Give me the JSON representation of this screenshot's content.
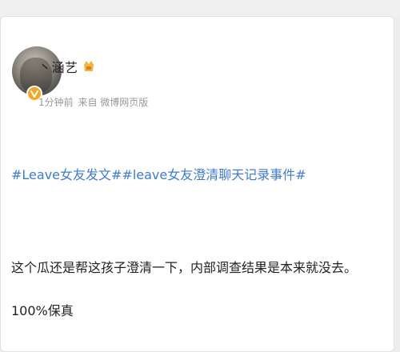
{
  "post": {
    "author": {
      "name": "丶涵艺",
      "verified_badge_icon": "verified-v-icon",
      "member_icon": "crown-icon"
    },
    "meta": {
      "time": "1分钟前",
      "source": "来自 微博网页版"
    },
    "hashtags": [
      "#Leave女友发文#",
      "#leave女友澄清聊天记录事件#"
    ],
    "paragraphs": [
      "这个瓜还是帮这孩子澄清一下，内部调查结果是本来就没去。",
      "100%保真"
    ]
  },
  "colors": {
    "link": "#3f7bd0",
    "text": "#222222",
    "meta": "#999999",
    "badge": "#f5a623"
  }
}
